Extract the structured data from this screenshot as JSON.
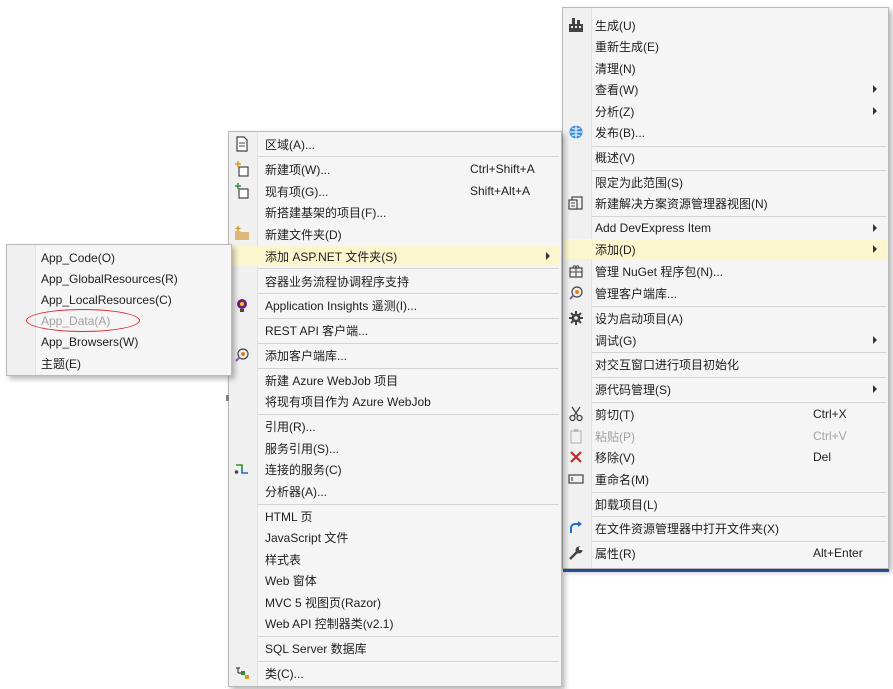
{
  "project_menu": {
    "items": [
      {
        "label": "生成(U)",
        "icon": "build-icon"
      },
      {
        "label": "重新生成(E)"
      },
      {
        "label": "清理(N)"
      },
      {
        "label": "查看(W)",
        "submenu": true
      },
      {
        "label": "分析(Z)",
        "submenu": true
      },
      {
        "label": "发布(B)...",
        "icon": "publish-globe-icon"
      },
      {
        "label": "概述(V)"
      },
      {
        "label": "限定为此范围(S)"
      },
      {
        "label": "新建解决方案资源管理器视图(N)",
        "icon": "new-view-icon"
      },
      {
        "label": "Add DevExpress Item",
        "submenu": true
      },
      {
        "label": "添加(D)",
        "submenu": true,
        "highlighted": true
      },
      {
        "label": "管理 NuGet 程序包(N)...",
        "icon": "nuget-icon"
      },
      {
        "label": "管理客户端库...",
        "icon": "client-library-icon"
      },
      {
        "label": "设为启动项目(A)",
        "icon": "gear-icon"
      },
      {
        "label": "调试(G)",
        "submenu": true
      },
      {
        "label": "对交互窗口进行项目初始化"
      },
      {
        "label": "源代码管理(S)",
        "submenu": true
      },
      {
        "label": "剪切(T)",
        "shortcut": "Ctrl+X",
        "icon": "cut-icon"
      },
      {
        "label": "粘贴(P)",
        "shortcut": "Ctrl+V",
        "icon": "paste-icon",
        "disabled": true
      },
      {
        "label": "移除(V)",
        "shortcut": "Del",
        "icon": "remove-x-icon"
      },
      {
        "label": "重命名(M)",
        "icon": "rename-icon"
      },
      {
        "label": "卸载项目(L)"
      },
      {
        "label": "在文件资源管理器中打开文件夹(X)",
        "icon": "open-folder-arrow-icon"
      },
      {
        "label": "属性(R)",
        "shortcut": "Alt+Enter",
        "icon": "wrench-icon"
      }
    ]
  },
  "add_menu": {
    "items": [
      {
        "label": "区域(A)...",
        "icon": "area-doc-icon"
      },
      {
        "label": "新建项(W)...",
        "shortcut": "Ctrl+Shift+A",
        "icon": "new-item-icon"
      },
      {
        "label": "现有项(G)...",
        "shortcut": "Shift+Alt+A",
        "icon": "existing-item-icon"
      },
      {
        "label": "新搭建基架的项目(F)..."
      },
      {
        "label": "新建文件夹(D)",
        "icon": "new-folder-icon"
      },
      {
        "label": "添加 ASP.NET 文件夹(S)",
        "submenu": true,
        "highlighted": true
      },
      {
        "label": "容器业务流程协调程序支持"
      },
      {
        "label": "Application Insights 遥测(I)...",
        "icon": "app-insights-icon"
      },
      {
        "label": "REST API 客户端..."
      },
      {
        "label": "添加客户端库...",
        "icon": "client-library-icon"
      },
      {
        "label": "新建 Azure WebJob 项目"
      },
      {
        "label": "将现有项目作为 Azure WebJob"
      },
      {
        "label": "引用(R)..."
      },
      {
        "label": "服务引用(S)..."
      },
      {
        "label": "连接的服务(C)",
        "icon": "connected-service-icon"
      },
      {
        "label": "分析器(A)..."
      },
      {
        "label": "HTML 页"
      },
      {
        "label": "JavaScript 文件"
      },
      {
        "label": "样式表"
      },
      {
        "label": "Web 窗体"
      },
      {
        "label": "MVC 5 视图页(Razor)"
      },
      {
        "label": "Web API 控制器类(v2.1)"
      },
      {
        "label": "SQL Server 数据库"
      },
      {
        "label": "类(C)...",
        "icon": "class-icon"
      }
    ]
  },
  "aspnet_menu": {
    "items": [
      {
        "label": "App_Code(O)"
      },
      {
        "label": "App_GlobalResources(R)"
      },
      {
        "label": "App_LocalResources(C)"
      },
      {
        "label": "App_Data(A)",
        "disabled": true
      },
      {
        "label": "App_Browsers(W)"
      },
      {
        "label": "主题(E)"
      }
    ]
  },
  "colors": {
    "highlight": "#fcf6cf",
    "annotation": "#d9282f",
    "accent": "#2a62b6"
  }
}
